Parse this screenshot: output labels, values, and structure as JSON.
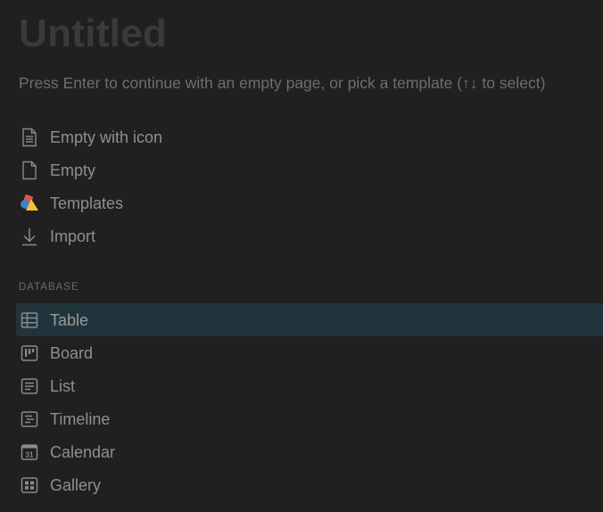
{
  "title": "Untitled",
  "hint": "Press Enter to continue with an empty page, or pick a template (↑↓ to select)",
  "menu": {
    "items": [
      {
        "label": "Empty with icon",
        "icon": "document-lines-icon"
      },
      {
        "label": "Empty",
        "icon": "document-icon"
      },
      {
        "label": "Templates",
        "icon": "templates-shapes-icon"
      },
      {
        "label": "Import",
        "icon": "import-arrow-icon"
      }
    ]
  },
  "database": {
    "section_label": "DATABASE",
    "items": [
      {
        "label": "Table",
        "icon": "table-icon",
        "selected": true
      },
      {
        "label": "Board",
        "icon": "board-icon"
      },
      {
        "label": "List",
        "icon": "list-icon"
      },
      {
        "label": "Timeline",
        "icon": "timeline-icon"
      },
      {
        "label": "Calendar",
        "icon": "calendar-icon",
        "icon_text": "31"
      },
      {
        "label": "Gallery",
        "icon": "gallery-icon"
      }
    ]
  },
  "colors": {
    "background": "#202020",
    "selected_row": "#22343b",
    "title": "#3a3a3a",
    "icon_gray": "#8a8a8a",
    "templates_red": "#e2524a",
    "templates_blue": "#3b82c4",
    "templates_yellow": "#f2c23a"
  }
}
